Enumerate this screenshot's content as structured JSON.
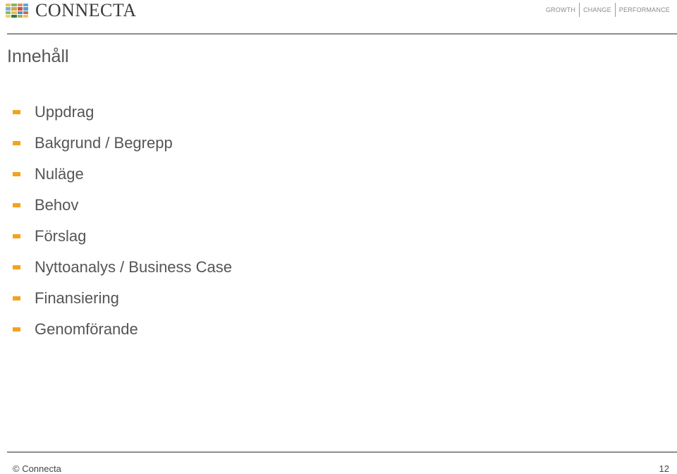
{
  "header": {
    "logo_text": "CONNECTA",
    "logo_grid_colors": [
      "#e7c25a",
      "#86b95a",
      "#e48a6a",
      "#6aa6d6",
      "#7bb0d8",
      "#d9a24a",
      "#c9544a",
      "#5b9fd1",
      "#8cbf4f",
      "#e0c050",
      "#4a8fcf",
      "#c96a5a",
      "#e9d36a",
      "#2f7a3f",
      "#bca55a",
      "#e8c85a"
    ],
    "tagline": [
      "GROWTH",
      "CHANGE",
      "PERFORMANCE"
    ]
  },
  "title": "Innehåll",
  "toc": {
    "bullet_color": "#f5a21b",
    "active_index": 3,
    "items": [
      {
        "label": "Uppdrag"
      },
      {
        "label": "Bakgrund / Begrepp"
      },
      {
        "label": "Nuläge"
      },
      {
        "label": "Behov"
      },
      {
        "label": "Förslag"
      },
      {
        "label": "Nyttoanalys / Business Case"
      },
      {
        "label": "Finansiering"
      },
      {
        "label": "Genomförande"
      }
    ]
  },
  "footer": {
    "copyright": "© Connecta",
    "page_number": "12"
  }
}
